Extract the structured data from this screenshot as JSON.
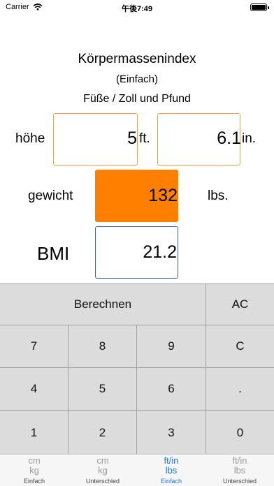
{
  "status_bar": {
    "carrier": "Carrier",
    "time": "午後7:49",
    "wifi_icon": "wifi-icon",
    "battery_icon": "battery-icon"
  },
  "header": {
    "title": "Körpermassenindex",
    "subtitle": "(Einfach)",
    "units": "Füße / Zoll und Pfund"
  },
  "height": {
    "label": "höhe",
    "feet": "5",
    "feet_unit": "ft.",
    "inches": "6.1",
    "inch_unit": "in."
  },
  "weight": {
    "label": "gewicht",
    "value": "132",
    "unit": "lbs."
  },
  "bmi": {
    "label": "BMI",
    "value": "21.2"
  },
  "keypad": {
    "calculate": "Berechnen",
    "all_clear": "AC",
    "row1": [
      "7",
      "8",
      "9",
      "C"
    ],
    "row2": [
      "4",
      "5",
      "6",
      "."
    ],
    "row3": [
      "1",
      "2",
      "3",
      "0"
    ]
  },
  "tabs": [
    {
      "line1": "cm",
      "line2": "kg",
      "caption": "Einfach",
      "active": false
    },
    {
      "line1": "cm",
      "line2": "kg",
      "caption": "Unterschied",
      "active": false
    },
    {
      "line1": "ft/in",
      "line2": "lbs",
      "caption": "Einfach",
      "active": true
    },
    {
      "line1": "ft/in",
      "line2": "lbs",
      "caption": "Unterschied",
      "active": false
    }
  ],
  "colors": {
    "accent_orange": "#ff8000",
    "field_border_orange": "#f0a030",
    "bmi_border_blue": "#3b5bdb",
    "tab_active": "#1a73e8",
    "tab_inactive": "#9a9a9a",
    "keypad_bg": "#dcdcdc"
  }
}
